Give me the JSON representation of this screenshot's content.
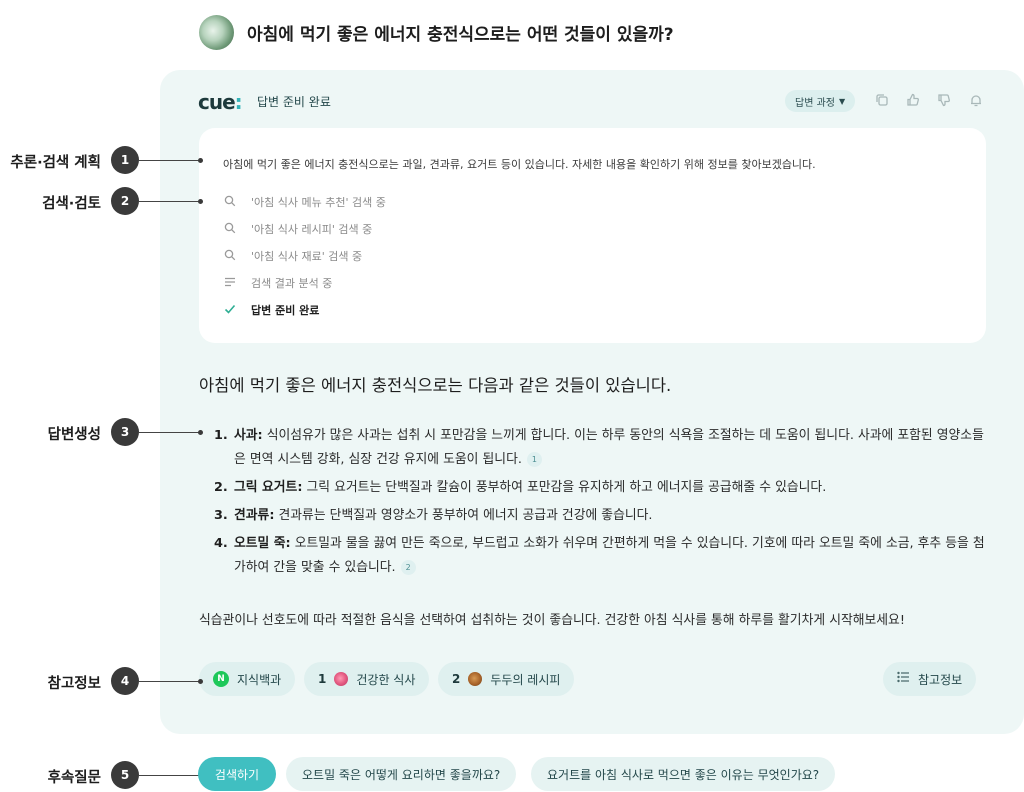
{
  "question": {
    "text": "아침에 먹기 좋은 에너지 충전식으로는 어떤 것들이 있을까?"
  },
  "header": {
    "logo_text": "cue",
    "logo_dot": ":",
    "status": "답변 준비 완료",
    "process_button": "답변 과정",
    "tools": [
      "copy-icon",
      "thumbs-up-icon",
      "thumbs-down-icon",
      "bell-icon"
    ]
  },
  "reasoning": {
    "plan": "아침에 먹기 좋은 에너지 충전식으로는 과일, 견과류, 요거트 등이 있습니다. 자세한 내용을 확인하기 위해 정보를 찾아보겠습니다.",
    "steps": [
      {
        "icon": "search-icon",
        "text": "'아침 식사 메뉴 추천' 검색 중"
      },
      {
        "icon": "search-icon",
        "text": "'아침 식사 레시피' 검색 중"
      },
      {
        "icon": "search-icon",
        "text": "'아침 식사 재료' 검색 중"
      },
      {
        "icon": "lines-icon",
        "text": "검색 결과 분석 중"
      },
      {
        "icon": "check-icon",
        "text": "답변 준비 완료"
      }
    ]
  },
  "answer": {
    "title": "아침에 먹기 좋은 에너지 충전식으로는 다음과 같은 것들이 있습니다.",
    "items": [
      {
        "num": "1.",
        "term": "사과:",
        "text": " 식이섬유가 많은 사과는 섭취 시 포만감을 느끼게 합니다. 이는 하루 동안의 식욕을 조절하는 데 도움이 됩니다. 사과에 포함된 영양소들은 면역 시스템 강화, 심장 건강 유지에 도움이 됩니다.",
        "cite": "1"
      },
      {
        "num": "2.",
        "term": "그릭 요거트:",
        "text": " 그릭 요거트는 단백질과 칼슘이 풍부하여 포만감을 유지하게 하고 에너지를 공급해줄 수 있습니다.",
        "cite": ""
      },
      {
        "num": "3.",
        "term": "견과류:",
        "text": " 견과류는 단백질과 영양소가 풍부하여 에너지 공급과 건강에 좋습니다.",
        "cite": ""
      },
      {
        "num": "4.",
        "term": "오트밀 죽:",
        "text": " 오트밀과 물을 끓여 만든 죽으로, 부드럽고 소화가 쉬우며 간편하게 먹을 수 있습니다. 기호에 따라 오트밀 죽에 소금, 후추 등을 첨가하여 간을 맞출 수 있습니다.",
        "cite": "2"
      }
    ],
    "closing": "식습관이나 선호도에 따라 적절한 음식을 선택하여 섭취하는 것이 좋습니다. 건강한 아침 식사를 통해 하루를 활기차게 시작해보세요!"
  },
  "references": {
    "items": [
      {
        "num": "",
        "badge": "N",
        "label": "지식백과"
      },
      {
        "num": "1",
        "badge": "",
        "label": "건강한 식사"
      },
      {
        "num": "2",
        "badge": "",
        "label": "두두의 레시피"
      }
    ],
    "all_label": "참고정보"
  },
  "annotations": [
    {
      "label": "추론·검색 계획",
      "num": "1"
    },
    {
      "label": "검색·검토",
      "num": "2"
    },
    {
      "label": "답변생성",
      "num": "3"
    },
    {
      "label": "참고정보",
      "num": "4"
    },
    {
      "label": "후속질문",
      "num": "5"
    }
  ],
  "followups": {
    "search_button": "검색하기",
    "questions": [
      "오트밀 죽은 어떻게 요리하면 좋을까요?",
      "요거트를 아침 식사로 먹으면 좋은 이유는 무엇인가요?"
    ]
  },
  "colors": {
    "accent": "#40bfc1",
    "card_bg": "#eef7f6",
    "check": "#2fae94",
    "naver_green": "#1ec85a"
  }
}
